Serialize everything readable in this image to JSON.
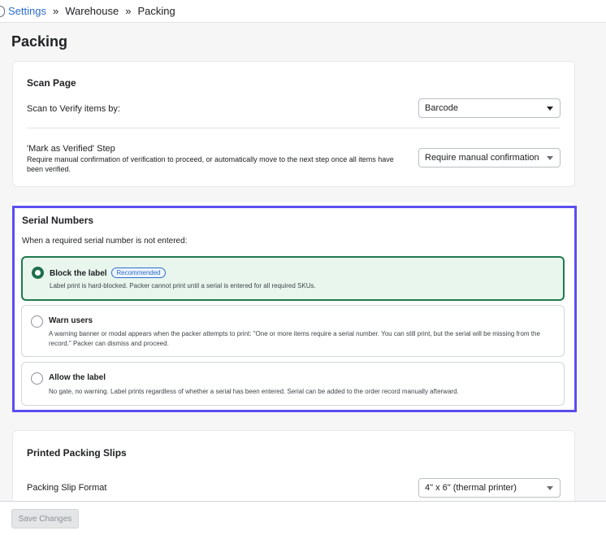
{
  "breadcrumb": {
    "items": [
      "Settings",
      "Warehouse",
      "Packing"
    ],
    "separator": "»"
  },
  "page": {
    "title": "Packing"
  },
  "scan_page": {
    "title": "Scan Page",
    "verify_label": "Scan to Verify items by:",
    "verify_value": "Barcode",
    "mark_verified_label": "'Mark as Verified' Step",
    "mark_verified_help": "Require manual confirmation of verification to proceed, or automatically move to the next step once all items have been verified.",
    "mark_verified_value": "Require manual confirmation"
  },
  "serial_numbers": {
    "title": "Serial Numbers",
    "subtitle": "When a required serial number is not entered:",
    "options": [
      {
        "title": "Block the label",
        "badge": "Recommended",
        "desc": "Label print is hard-blocked. Packer cannot print until a serial is entered for all required SKUs.",
        "selected": true
      },
      {
        "title": "Warn users",
        "badge": "",
        "desc": "A warning banner or modal appears when the packer attempts to print: \"One or more items require a serial number. You can still print, but the serial will be missing from the record.\" Packer can dismiss and proceed.",
        "selected": false
      },
      {
        "title": "Allow the label",
        "badge": "",
        "desc": "No gate, no warning. Label prints regardless of whether a serial has been entered. Serial can be added to the order record manually afterward.",
        "selected": false
      }
    ]
  },
  "packing_slips": {
    "title": "Printed Packing Slips",
    "format_label": "Packing Slip Format",
    "format_value": "4\" x 6\" (thermal printer)"
  },
  "footer": {
    "save_label": "Save Changes"
  },
  "colors": {
    "accent": "#5b4ef0",
    "selected_green": "#1f7a4d",
    "link": "#2c6ecb"
  }
}
